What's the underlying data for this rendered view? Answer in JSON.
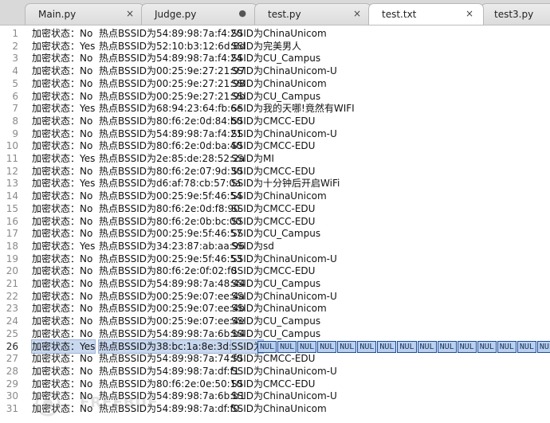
{
  "tabs": [
    {
      "label": "Main.py",
      "close": "×"
    },
    {
      "label": "Judge.py",
      "dot": "●"
    },
    {
      "label": "test.py",
      "close": "×"
    },
    {
      "label": "test.txt",
      "close": "×"
    },
    {
      "label": "test3.py"
    }
  ],
  "lines": [
    {
      "n": "1",
      "state": "加密状态：No",
      "bssid": "热点BSSID为54:89:98:7a:f4:20",
      "ssid": "SSID为ChinaUnicom"
    },
    {
      "n": "2",
      "state": "加密状态：Yes",
      "bssid": "热点BSSID为52:10:b3:12:6d:8d",
      "ssid": "SSID为完美男人"
    },
    {
      "n": "3",
      "state": "加密状态：No",
      "bssid": "热点BSSID为54:89:98:7a:f4:24",
      "ssid": "SSID为CU_Campus"
    },
    {
      "n": "4",
      "state": "加密状态：No",
      "bssid": "热点BSSID为00:25:9e:27:21:97",
      "ssid": "SSID为ChinaUnicom-U"
    },
    {
      "n": "5",
      "state": "加密状态：No",
      "bssid": "热点BSSID为00:25:9e:27:21:98",
      "ssid": "SSID为ChinaUnicom"
    },
    {
      "n": "6",
      "state": "加密状态：No",
      "bssid": "热点BSSID为00:25:9e:27:21:9b",
      "ssid": "SSID为CU_Campus"
    },
    {
      "n": "7",
      "state": "加密状态：Yes",
      "bssid": "热点BSSID为68:94:23:64:fb:6e",
      "ssid": "SSID为我的天哪!竟然有WIFI"
    },
    {
      "n": "8",
      "state": "加密状态：No",
      "bssid": "热点BSSID为80:f6:2e:0d:84:b0",
      "ssid": "SSID为CMCC-EDU"
    },
    {
      "n": "9",
      "state": "加密状态：No",
      "bssid": "热点BSSID为54:89:98:7a:f4:21",
      "ssid": "SSID为ChinaUnicom-U"
    },
    {
      "n": "10",
      "state": "加密状态：No",
      "bssid": "热点BSSID为80:f6:2e:0d:ba:40",
      "ssid": "SSID为CMCC-EDU"
    },
    {
      "n": "11",
      "state": "加密状态：Yes",
      "bssid": "热点BSSID为2e:85:de:28:52:2a",
      "ssid": "SSID为MI"
    },
    {
      "n": "12",
      "state": "加密状态：No",
      "bssid": "热点BSSID为80:f6:2e:07:9d:30",
      "ssid": "SSID为CMCC-EDU"
    },
    {
      "n": "13",
      "state": "加密状态：Yes",
      "bssid": "热点BSSID为d6:af:78:cb:57:0a",
      "ssid": "SSID为十分钟后开启WiFi"
    },
    {
      "n": "14",
      "state": "加密状态：No",
      "bssid": "热点BSSID为00:25:9e:5f:46:54",
      "ssid": "SSID为ChinaUnicom"
    },
    {
      "n": "15",
      "state": "加密状态：No",
      "bssid": "热点BSSID为80:f6:2e:0d:f8:90",
      "ssid": "SSID为CMCC-EDU"
    },
    {
      "n": "16",
      "state": "加密状态：No",
      "bssid": "热点BSSID为80:f6:2e:0b:bc:00",
      "ssid": "SSID为CMCC-EDU"
    },
    {
      "n": "17",
      "state": "加密状态：No",
      "bssid": "热点BSSID为00:25:9e:5f:46:57",
      "ssid": "SSID为CU_Campus"
    },
    {
      "n": "18",
      "state": "加密状态：Yes",
      "bssid": "热点BSSID为34:23:87:ab:aa:96",
      "ssid": "SSID为sd"
    },
    {
      "n": "19",
      "state": "加密状态：No",
      "bssid": "热点BSSID为00:25:9e:5f:46:53",
      "ssid": "SSID为ChinaUnicom-U"
    },
    {
      "n": "20",
      "state": "加密状态：No",
      "bssid": "热点BSSID为80:f6:2e:0f:02:f0",
      "ssid": "SSID为CMCC-EDU"
    },
    {
      "n": "21",
      "state": "加密状态：No",
      "bssid": "热点BSSID为54:89:98:7a:48:44",
      "ssid": "SSID为CU_Campus"
    },
    {
      "n": "22",
      "state": "加密状态：No",
      "bssid": "热点BSSID为00:25:9e:07:ee:4a",
      "ssid": "SSID为ChinaUnicom-U"
    },
    {
      "n": "23",
      "state": "加密状态：No",
      "bssid": "热点BSSID为00:25:9e:07:ee:4b",
      "ssid": "SSID为ChinaUnicom"
    },
    {
      "n": "24",
      "state": "加密状态：No",
      "bssid": "热点BSSID为00:25:9e:07:ee:4e",
      "ssid": "SSID为CU_Campus"
    },
    {
      "n": "25",
      "state": "加密状态：No",
      "bssid": "热点BSSID为54:89:98:7a:6b:b4",
      "ssid": "SSID为CU_Campus"
    },
    {
      "n": "26",
      "state": "加密状态：Yes",
      "bssid": "热点BSSID为38:bc:1a:8e:3d:34",
      "ssid": "SSID为",
      "nul": [
        "NUL",
        "NUL",
        "NUL",
        "NUL",
        "NUL",
        "NUL",
        "NUL",
        "NUL",
        "NUL",
        "NUL",
        "NUL",
        "NUL",
        "NUL",
        "NUL",
        "NUL"
      ],
      "selected": true
    },
    {
      "n": "27",
      "state": "加密状态：No",
      "bssid": "热点BSSID为54:89:98:7a:74:f0",
      "ssid": "SSID为CMCC-EDU"
    },
    {
      "n": "28",
      "state": "加密状态：No",
      "bssid": "热点BSSID为54:89:98:7a:df:f1",
      "ssid": "SSID为ChinaUnicom-U"
    },
    {
      "n": "29",
      "state": "加密状态：No",
      "bssid": "热点BSSID为80:f6:2e:0e:50:10",
      "ssid": "SSID为CMCC-EDU"
    },
    {
      "n": "30",
      "state": "加密状态：No",
      "bssid": "热点BSSID为54:89:98:7a:6b:b1",
      "ssid": "SSID为ChinaUnicom-U"
    },
    {
      "n": "31",
      "state": "加密状态：No",
      "bssid": "热点BSSID为54:89:98:7a:df:f0",
      "ssid": "SSID为ChinaUnicom"
    }
  ],
  "watermark": "FREEBUF"
}
